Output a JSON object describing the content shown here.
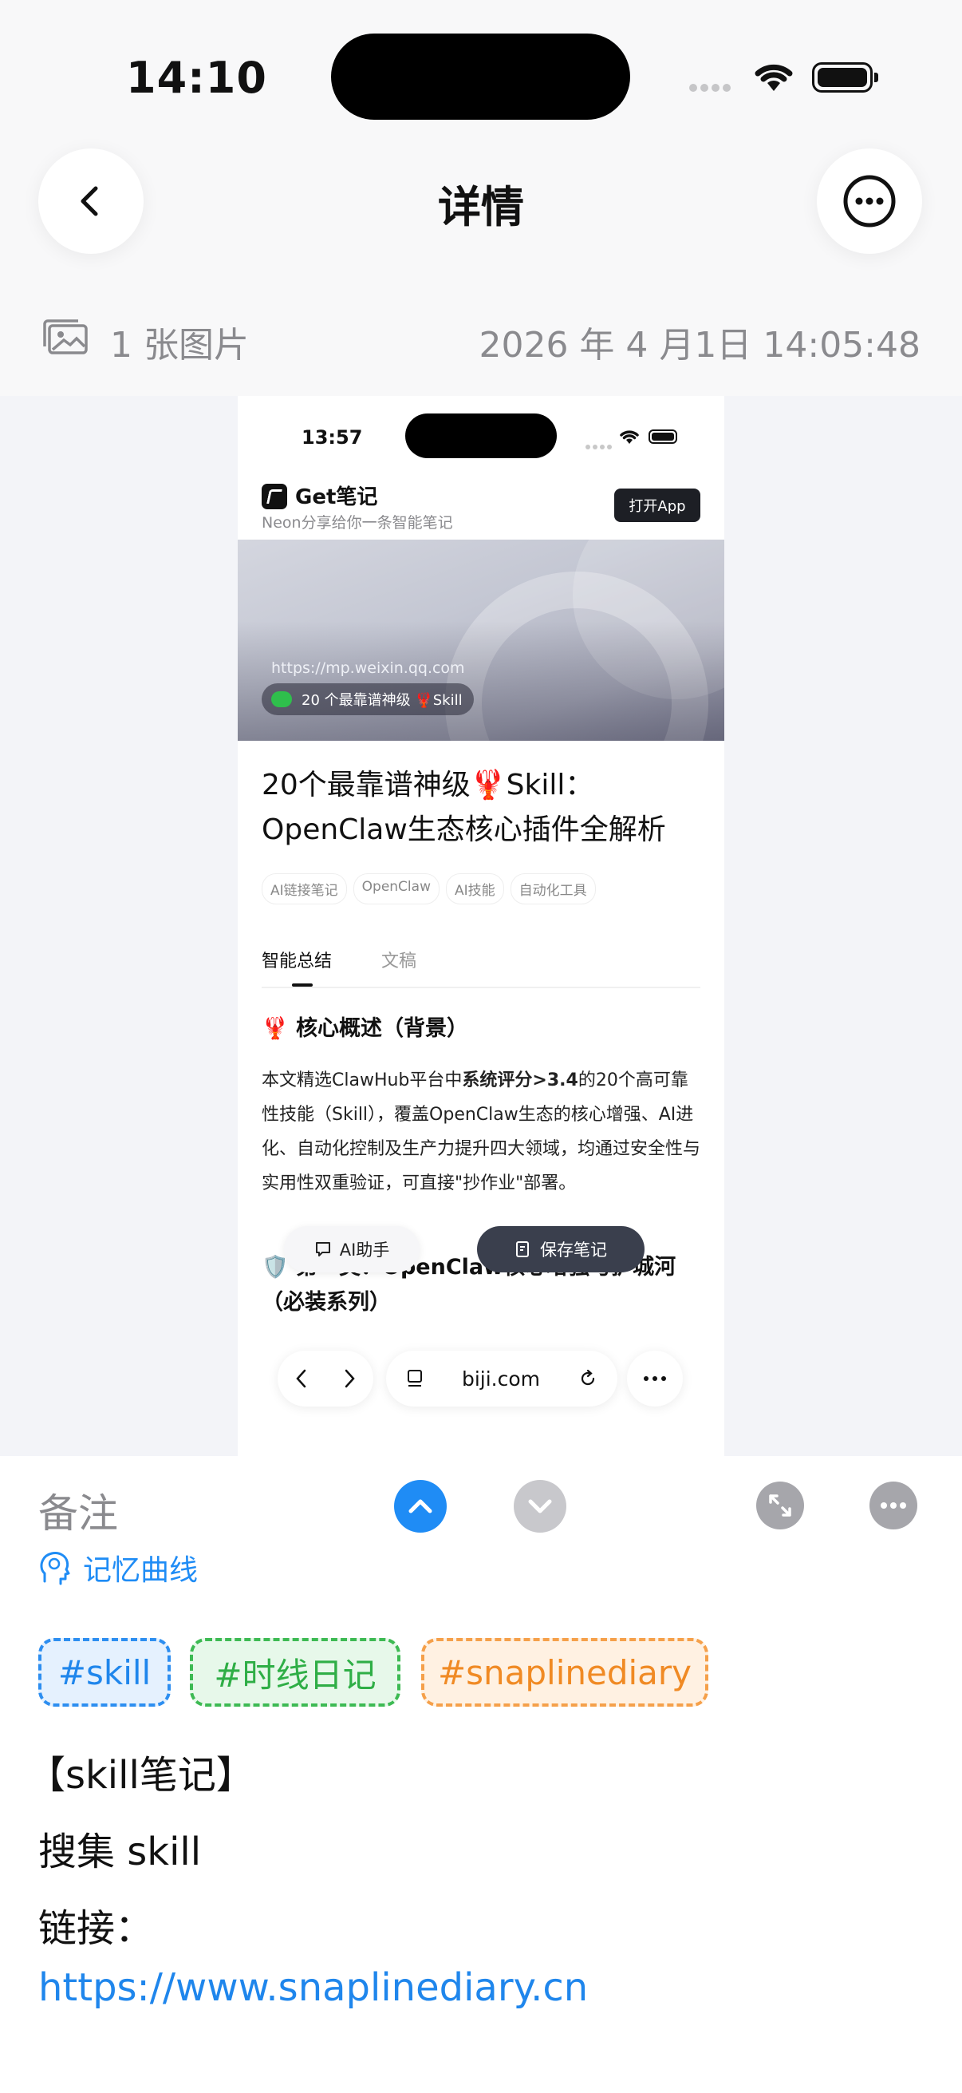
{
  "status_bar": {
    "time": "14:10"
  },
  "nav": {
    "title": "详情"
  },
  "meta": {
    "image_count": "1 张图片",
    "datetime": "2026 年 4 月1日 14:05:48"
  },
  "screenshot": {
    "status_time": "13:57",
    "app_name": "Get笔记",
    "share_text": "Neon分享给你一条智能笔记",
    "open_app": "打开App",
    "banner_url": "https://mp.weixin.qq.com",
    "banner_pill": "20 个最靠谱神级 🦞Skill",
    "title": "20个最靠谱神级🦞Skill：OpenClaw生态核心插件全解析",
    "tags": [
      "AI链接笔记",
      "OpenClaw",
      "AI技能",
      "自动化工具"
    ],
    "tabs": [
      "智能总结",
      "文稿"
    ],
    "heading1": "🦞 核心概述（背景）",
    "para_pre": "本文精选ClawHub平台中",
    "para_bold": "系统评分>3.4",
    "para_post": "的20个高可靠性技能（Skill），覆盖OpenClaw生态的核心增强、AI进化、自动化控制及生产力提升四大领域，均通过安全性与实用性双重验证，可直接\"抄作业\"部署。",
    "heading2": "🛡️ 第一类：OpenClaw核心增强与护城河（必装系列）",
    "ai_button": "AI助手",
    "save_button": "保存笔记",
    "browser_url": "biji.com"
  },
  "note": {
    "label": "备注",
    "memory_curve": "记忆曲线",
    "tags": [
      "#skill",
      "#时线日记",
      "#snaplinediary"
    ],
    "lines": [
      "【skill笔记】",
      "搜集 skill",
      "链接："
    ],
    "link": "https://www.snaplinediary.cn"
  },
  "colors": {
    "accent": "#1f8cf5",
    "tag_green": "#2fae46",
    "tag_orange": "#f08a24"
  }
}
